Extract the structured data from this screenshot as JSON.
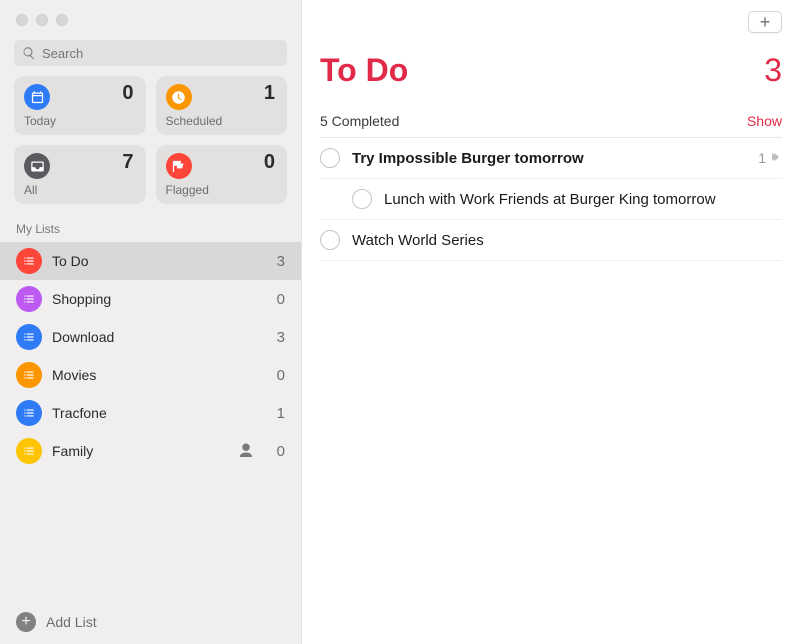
{
  "search": {
    "placeholder": "Search"
  },
  "smart": {
    "today": {
      "label": "Today",
      "count": "0"
    },
    "scheduled": {
      "label": "Scheduled",
      "count": "1"
    },
    "all": {
      "label": "All",
      "count": "7"
    },
    "flagged": {
      "label": "Flagged",
      "count": "0"
    }
  },
  "section_label": "My Lists",
  "lists": [
    {
      "name": "To Do",
      "count": "3",
      "color": "c-red",
      "selected": true,
      "shared": false
    },
    {
      "name": "Shopping",
      "count": "0",
      "color": "c-purple",
      "selected": false,
      "shared": false
    },
    {
      "name": "Download",
      "count": "3",
      "color": "c-blue",
      "selected": false,
      "shared": false
    },
    {
      "name": "Movies",
      "count": "0",
      "color": "c-orange",
      "selected": false,
      "shared": false
    },
    {
      "name": "Tracfone",
      "count": "1",
      "color": "c-blue2",
      "selected": false,
      "shared": false
    },
    {
      "name": "Family",
      "count": "0",
      "color": "c-yellow",
      "selected": false,
      "shared": true
    }
  ],
  "add_list_label": "Add List",
  "main": {
    "title": "To Do",
    "count": "3",
    "completed_label": "5 Completed",
    "show_label": "Show",
    "tasks": [
      {
        "text": "Try Impossible Burger tomorrow",
        "bold": true,
        "subtask_count": "1",
        "has_subtasks": true,
        "indent": 0
      },
      {
        "text": "Lunch with Work Friends at Burger King tomorrow",
        "bold": false,
        "indent": 1
      },
      {
        "text": "Watch World Series",
        "bold": false,
        "indent": 0
      }
    ]
  }
}
